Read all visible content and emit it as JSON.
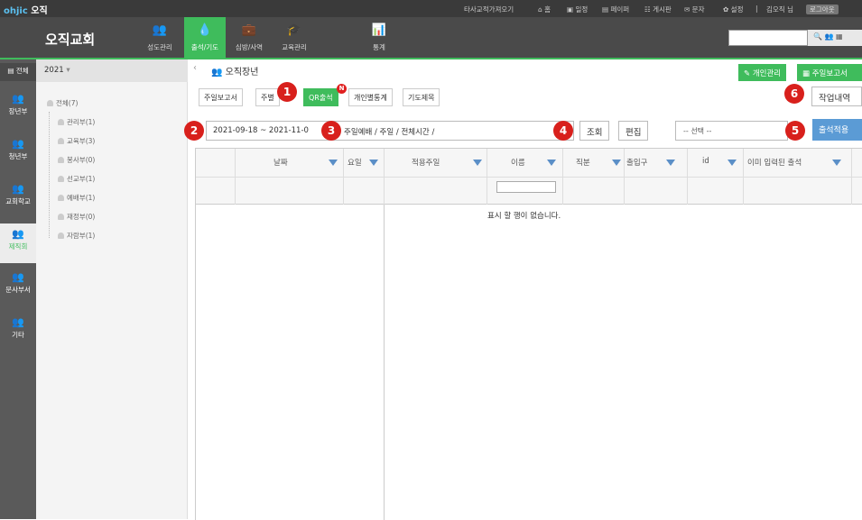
{
  "topbar": {
    "logo_brand": "ohjic",
    "logo_text": "오직",
    "links": [
      "타사교적가져오기",
      "홈",
      "일정",
      "페이퍼",
      "게시판",
      "문자",
      "설정"
    ],
    "user": "김오직 님",
    "logout": "로그아웃"
  },
  "navbar": {
    "church_name": "오직교회",
    "items": [
      {
        "label": "성도관리",
        "icon": "people-icon"
      },
      {
        "label": "출석/기도",
        "icon": "drop-icon"
      },
      {
        "label": "심방/사역",
        "icon": "briefcase-icon"
      },
      {
        "label": "교육관리",
        "icon": "graduation-cap-icon"
      },
      {
        "label": "통계",
        "icon": "bar-chart-icon"
      }
    ],
    "active": "출석/기도",
    "search_placeholder": ""
  },
  "leftnav": {
    "top_label": "전체",
    "items": [
      "장년부",
      "청년부",
      "교회학교",
      "제직회",
      "문사부서",
      "기타"
    ],
    "active": "제직회"
  },
  "tree": {
    "year": "2021",
    "root": "전체(7)",
    "children": [
      "관리부(1)",
      "교육부(3)",
      "봉사부(0)",
      "선교부(1)",
      "예배부(1)",
      "재정부(0)",
      "자람부(1)"
    ]
  },
  "page": {
    "title": "오직장년",
    "personal_btn": "개인관리",
    "weekly_btn": "주일보고서",
    "work_history_btn": "작업내역",
    "tabs": [
      "주일보고서",
      "주별",
      "QR출석",
      "개인별통계",
      "기도제목"
    ],
    "active_tab": "QR출석",
    "new_badge": "N",
    "date_range": "2021-09-18 ~ 2021-11-0",
    "filter_text": "주일예배 / 주일 / 전체시간 /",
    "search_btn": "조회",
    "edit_btn": "편집",
    "select_value": "-- 선택 --",
    "apply_btn": "출석적용",
    "markers": [
      "1",
      "2",
      "3",
      "4",
      "5",
      "6"
    ]
  },
  "grid": {
    "columns": [
      "날짜",
      "요일",
      "적용주일",
      "이름",
      "직분",
      "출입구",
      "id",
      "이미 입력된 출석"
    ],
    "empty_message": "표시 할 행이 없습니다."
  },
  "colors": {
    "accent": "#3fbc5c",
    "topbar": "#3a3a3a",
    "navbar": "#4a4a4a",
    "leftnav": "#5a5a5a",
    "marker": "#d8201c",
    "apply": "#5b9bd5",
    "filter_icon": "#5b8fc7"
  }
}
